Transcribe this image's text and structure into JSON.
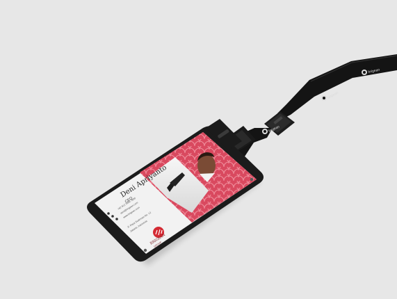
{
  "badge": {
    "name": "Deni Apriyanto",
    "role": "CEO",
    "brand": "BRIGEAN",
    "brand_sub": "GROUP",
    "contact_lines": [
      "+62 812 3456 7890",
      "deni@brigean.com",
      "www.brigean.com"
    ],
    "address_lines": [
      "Jl. Raya Sudirman No. 12",
      "Jakarta, Indonesia"
    ]
  },
  "lanyard": {
    "logo_label": "brigean"
  },
  "colors": {
    "background": "#e7e7e7",
    "pattern_red": "#d9495f",
    "strap": "#151515",
    "brand_red": "#d42a33"
  }
}
